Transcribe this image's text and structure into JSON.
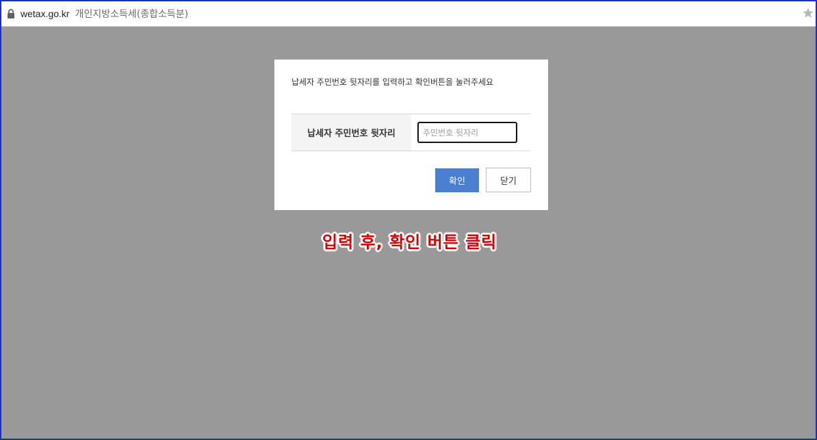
{
  "browser": {
    "domain": "wetax.go.kr",
    "page_title": "개인지방소득세(종합소득분)"
  },
  "modal": {
    "message": "납세자 주민번호 뒷자리를 입력하고 확인버튼을 눌러주세요",
    "field_label": "납세자 주민번호 뒷자리",
    "input_placeholder": "주민번호 뒷자리",
    "input_value": "",
    "confirm_label": "확인",
    "close_label": "닫기"
  },
  "annotation": {
    "text": "입력 후, 확인 버튼 클릭",
    "color": "#d40000"
  },
  "colors": {
    "overlay": "#999999",
    "confirm_button": "#4a7fd0",
    "frame_border": "#1a2fbf"
  }
}
